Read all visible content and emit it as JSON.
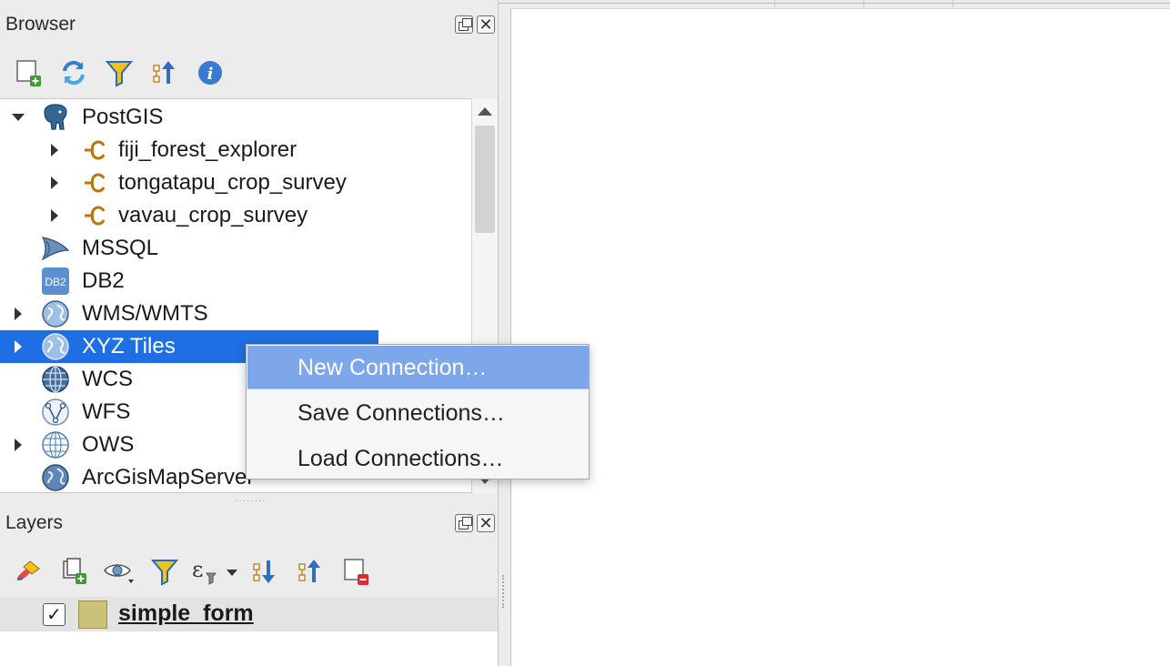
{
  "browser_panel": {
    "title": "Browser",
    "toolbar_icons": [
      "add-layer-icon",
      "refresh-icon",
      "filter-icon",
      "collapse-all-icon",
      "info-icon"
    ],
    "tree": [
      {
        "label": "PostGIS",
        "icon": "postgis-elephant-icon",
        "expanded": true
      },
      {
        "label": "fiji_forest_explorer",
        "icon": "connection-icon",
        "expanded": false
      },
      {
        "label": "tongatapu_crop_survey",
        "icon": "connection-icon",
        "expanded": false
      },
      {
        "label": "vavau_crop_survey",
        "icon": "connection-icon",
        "expanded": false
      },
      {
        "label": "MSSQL",
        "icon": "mssql-icon"
      },
      {
        "label": "DB2",
        "icon": "db2-icon"
      },
      {
        "label": "WMS/WMTS",
        "icon": "globe-icon",
        "expanded": false
      },
      {
        "label": "XYZ Tiles",
        "icon": "globe-icon",
        "expanded": false,
        "selected": true
      },
      {
        "label": "WCS",
        "icon": "globe-icon"
      },
      {
        "label": "WFS",
        "icon": "wfs-icon"
      },
      {
        "label": "OWS",
        "icon": "globe-outline-icon",
        "expanded": false
      },
      {
        "label": "ArcGisMapServer",
        "icon": "globe-icon"
      }
    ],
    "db2_badge": "DB2"
  },
  "layers_panel": {
    "title": "Layers",
    "toolbar_icons": [
      "style-brush-icon",
      "add-group-icon",
      "visibility-eye-icon",
      "filter-icon",
      "expression-filter-icon",
      "expand-all-icon",
      "collapse-all-icon",
      "remove-layer-icon"
    ],
    "expression_glyph": "ε",
    "layers": [
      {
        "name": "simple_form",
        "checked": true,
        "swatch_color": "#ccc17a"
      }
    ],
    "check_glyph": "✓"
  },
  "context_menu": {
    "items": [
      {
        "label": "New Connection…",
        "active": true
      },
      {
        "label": "Save Connections…",
        "active": false
      },
      {
        "label": "Load Connections…",
        "active": false
      }
    ]
  },
  "dock_buttons": {
    "float_label": "",
    "close_label": "✕"
  },
  "colors": {
    "selection": "#1e6fe3",
    "menu_highlight": "#7ea6ea"
  }
}
